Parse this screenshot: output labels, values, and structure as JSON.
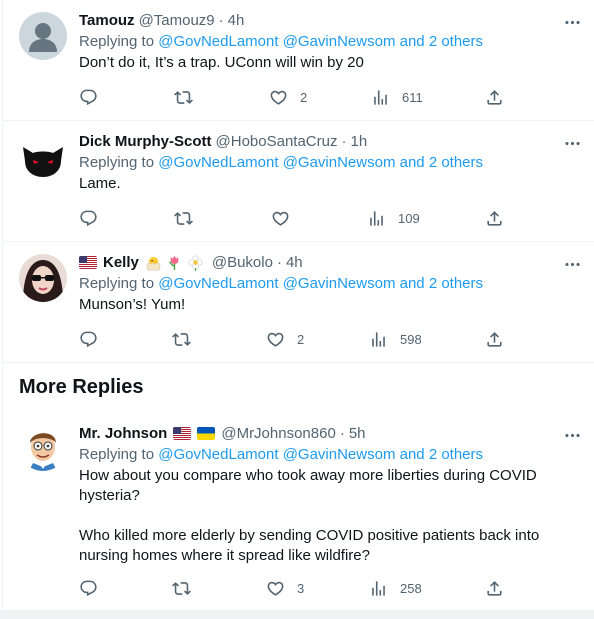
{
  "tweets": [
    {
      "name": "Tamouz",
      "handle": "@Tamouz9",
      "time": "4h",
      "replying_prefix": "Replying to",
      "mentions": [
        "@GovNedLamont",
        "@GavinNewsom",
        "and 2 others"
      ],
      "text": "Don’t do it, It’s a trap. UConn will win by 20",
      "likes": "2",
      "views": "611"
    },
    {
      "name": "Dick Murphy-Scott",
      "handle": "@HoboSantaCruz",
      "time": "1h",
      "replying_prefix": "Replying to",
      "mentions": [
        "@GovNedLamont",
        "@GavinNewsom",
        "and 2 others"
      ],
      "text": "Lame.",
      "likes": "",
      "views": "109"
    },
    {
      "name": "Kelly",
      "handle": "@Bukolo",
      "time": "4h",
      "replying_prefix": "Replying to",
      "mentions": [
        "@GovNedLamont",
        "@GavinNewsom",
        "and 2 others"
      ],
      "text": "Munson’s! Yum!",
      "likes": "2",
      "views": "598"
    },
    {
      "name": "Mr. Johnson",
      "handle": "@MrJohnson860",
      "time": "5h",
      "replying_prefix": "Replying to",
      "mentions": [
        "@GovNedLamont",
        "@GavinNewsom",
        "and 2 others"
      ],
      "text": "How about you compare who took away more liberties during COVID hysteria?\n\nWho killed more elderly by sending COVID positive patients back into nursing homes where it spread like wildfire?",
      "likes": "3",
      "views": "258"
    }
  ],
  "section_title": "More Replies",
  "icons": {
    "reply": "reply-icon",
    "retweet": "retweet-icon",
    "like": "heart-icon",
    "views": "views-icon",
    "share": "share-icon",
    "more": "more-icon"
  },
  "colors": {
    "accent": "#1d9bf0",
    "muted": "#536471",
    "text": "#0f1419",
    "divider": "#eff3f4"
  }
}
